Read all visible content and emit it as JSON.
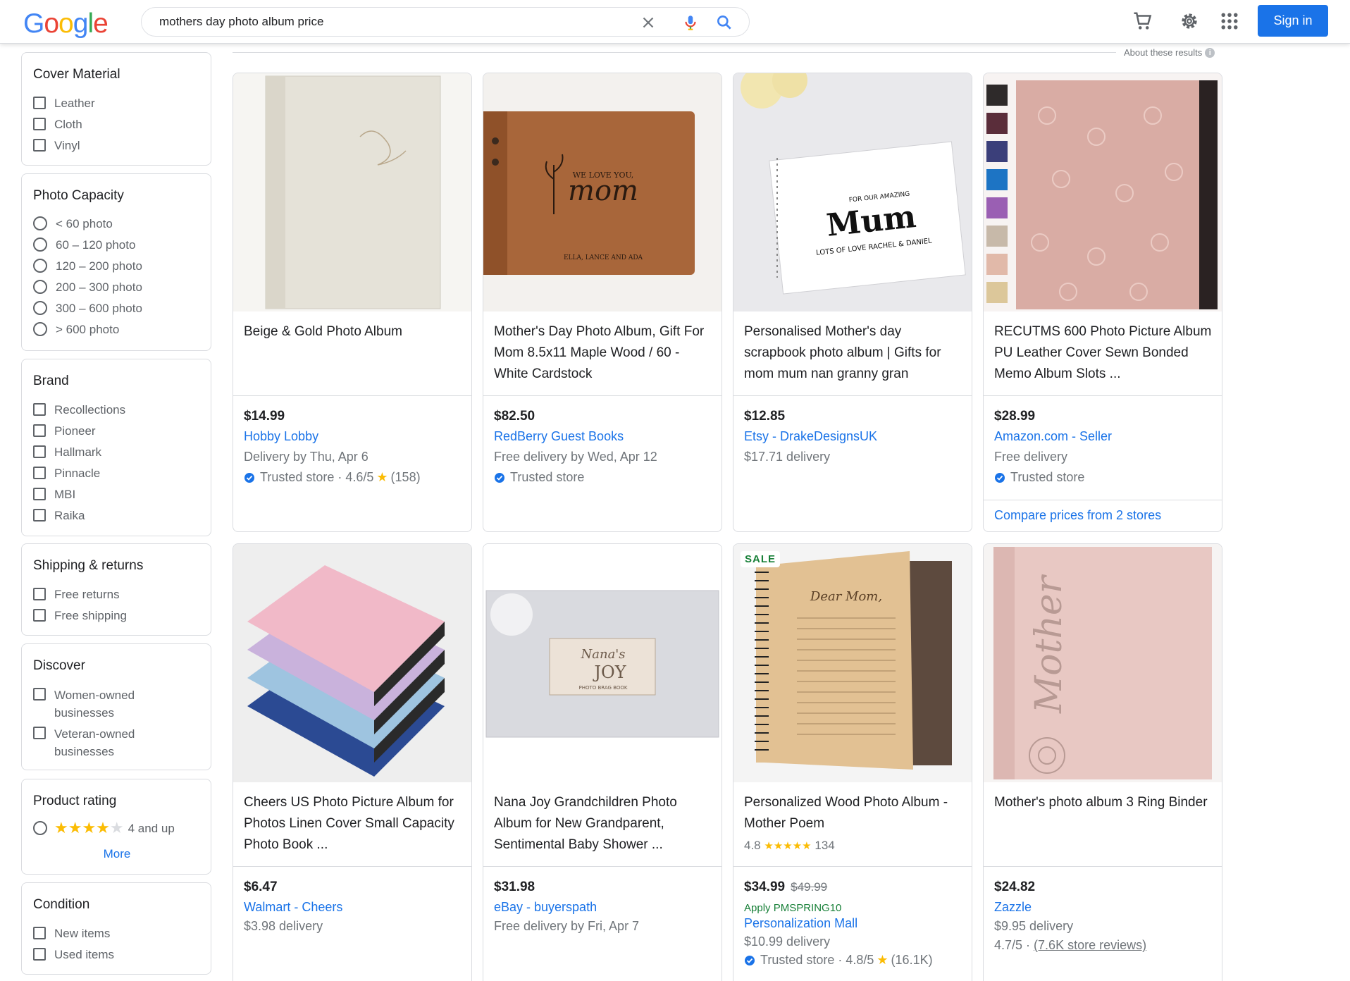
{
  "header": {
    "logo": [
      "G",
      "o",
      "o",
      "g",
      "l",
      "e"
    ],
    "logo_colors": [
      "#4285F4",
      "#EA4335",
      "#FBBC05",
      "#4285F4",
      "#34A853",
      "#EA4335"
    ],
    "search_value": "mothers day photo album price",
    "sign_in": "Sign in",
    "icons": [
      "clear-icon",
      "mic-icon",
      "search-icon",
      "cart-icon",
      "gear-icon",
      "apps-icon"
    ]
  },
  "sidebar": {
    "cover_material": {
      "title": "Cover Material",
      "options": [
        "Leather",
        "Cloth",
        "Vinyl"
      ]
    },
    "photo_capacity": {
      "title": "Photo Capacity",
      "options": [
        "< 60 photo",
        "60 – 120 photo",
        "120 – 200 photo",
        "200 – 300 photo",
        "300 – 600 photo",
        "> 600 photo"
      ]
    },
    "brand": {
      "title": "Brand",
      "options": [
        "Recollections",
        "Pioneer",
        "Hallmark",
        "Pinnacle",
        "MBI",
        "Raika"
      ]
    },
    "shipping": {
      "title": "Shipping & returns",
      "options": [
        "Free returns",
        "Free shipping"
      ]
    },
    "discover": {
      "title": "Discover",
      "options": [
        "Women-owned businesses",
        "Veteran-owned businesses"
      ]
    },
    "rating": {
      "title": "Product rating",
      "stars": 4,
      "label": "4 and up",
      "more": "More"
    },
    "condition": {
      "title": "Condition",
      "options": [
        "New items",
        "Used items"
      ]
    }
  },
  "results": {
    "about": "About these results",
    "info": "i",
    "products": [
      {
        "title": "Beige & Gold Photo Album",
        "price": "$14.99",
        "store": "Hobby Lobby",
        "detail": "Delivery by Thu, Apr 6",
        "trusted": "Trusted store · 4.6/5",
        "rating_count": "(158)"
      },
      {
        "title": "Mother's Day Photo Album, Gift For Mom 8.5x11 Maple Wood / 60 - White Cardstock",
        "price": "$82.50",
        "store": "RedBerry Guest Books",
        "detail": "Free delivery by Wed, Apr 12",
        "trusted": "Trusted store"
      },
      {
        "title": "Personalised Mother's day scrapbook photo album | Gifts for mom mum nan granny gran",
        "price": "$12.85",
        "store": "Etsy - DrakeDesignsUK",
        "detail": "$17.71 delivery"
      },
      {
        "title": "RECUTMS 600 Photo Picture Album PU Leather Cover Sewn Bonded Memo Album Slots ...",
        "price": "$28.99",
        "store": "Amazon.com - Seller",
        "detail": "Free delivery",
        "trusted": "Trusted store",
        "compare": "Compare prices from 2 stores"
      },
      {
        "title": "Cheers US Photo Picture Album for Photos Linen Cover Small Capacity Photo Book ...",
        "price": "$6.47",
        "store": "Walmart - Cheers",
        "detail": "$3.98 delivery"
      },
      {
        "title": "Nana Joy Grandchildren Photo Album for New Grandparent, Sentimental Baby Shower ...",
        "price": "$31.98",
        "store": "eBay - buyerspath",
        "detail": "Free delivery by Fri, Apr 7"
      },
      {
        "title": "Personalized Wood Photo Album - Mother Poem",
        "rating": "4.8",
        "rating_stars": "★★★★★",
        "reviews": "134",
        "sale": "SALE",
        "price": "$34.99",
        "old_price": "$49.99",
        "promo": "Apply PMSPRING10",
        "store": "Personalization Mall",
        "detail": "$10.99 delivery",
        "trusted": "Trusted store · 4.8/5",
        "rating_count": "(16.1K)"
      },
      {
        "title": "Mother's photo album 3 Ring Binder",
        "price": "$24.82",
        "store": "Zazzle",
        "detail": "$9.95 delivery",
        "store_rating": "4.7/5 ·",
        "store_reviews": "(7.6K store reviews)"
      }
    ]
  }
}
